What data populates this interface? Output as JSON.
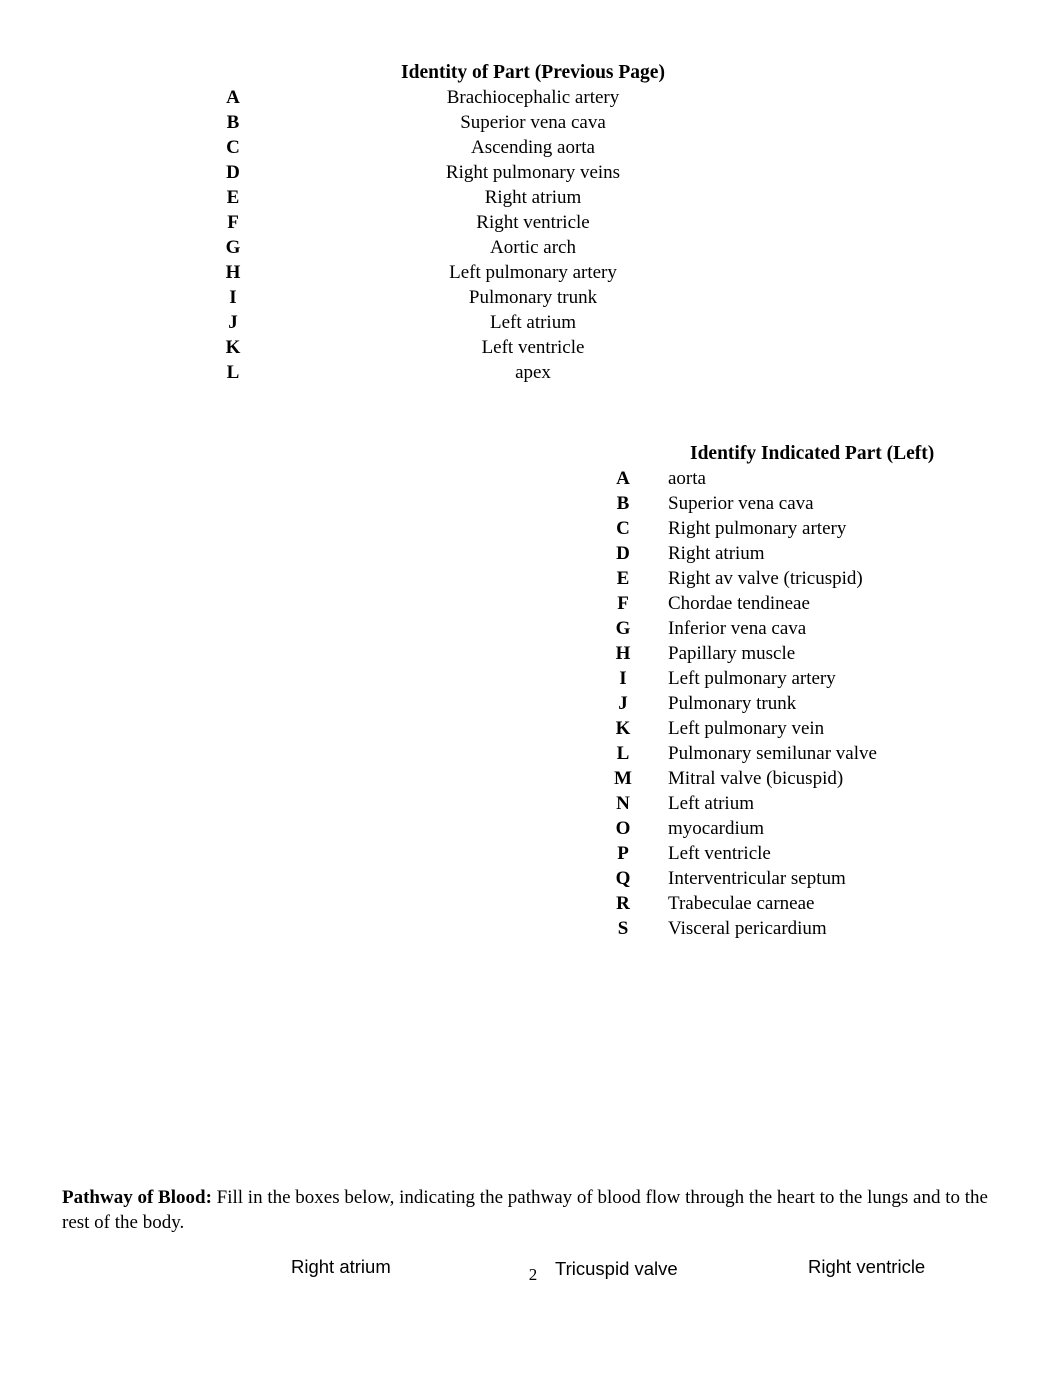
{
  "page": {
    "number": "2",
    "background_color": "#ffffff",
    "text_color": "#000000"
  },
  "section_one": {
    "title": "Identity of Part (Previous Page)",
    "items": [
      {
        "letter": "A",
        "part": "Brachiocephalic artery"
      },
      {
        "letter": "B",
        "part": "Superior vena cava"
      },
      {
        "letter": "C",
        "part": "Ascending aorta"
      },
      {
        "letter": "D",
        "part": "Right pulmonary veins"
      },
      {
        "letter": "E",
        "part": "Right atrium"
      },
      {
        "letter": "F",
        "part": "Right ventricle"
      },
      {
        "letter": "G",
        "part": "Aortic arch"
      },
      {
        "letter": "H",
        "part": "Left pulmonary artery"
      },
      {
        "letter": "I",
        "part": "Pulmonary trunk"
      },
      {
        "letter": "J",
        "part": "Left atrium"
      },
      {
        "letter": "K",
        "part": "Left ventricle"
      },
      {
        "letter": "L",
        "part": "apex"
      }
    ]
  },
  "section_two": {
    "title": "Identify Indicated Part (Left)",
    "items": [
      {
        "letter": "A",
        "part": "aorta"
      },
      {
        "letter": "B",
        "part": "Superior vena cava"
      },
      {
        "letter": "C",
        "part": "Right pulmonary artery"
      },
      {
        "letter": "D",
        "part": "Right atrium"
      },
      {
        "letter": "E",
        "part": "Right av valve (tricuspid)"
      },
      {
        "letter": "F",
        "part": "Chordae tendineae"
      },
      {
        "letter": "G",
        "part": "Inferior vena cava"
      },
      {
        "letter": "H",
        "part": "Papillary muscle"
      },
      {
        "letter": "I",
        "part": "Left pulmonary artery"
      },
      {
        "letter": "J",
        "part": "Pulmonary trunk"
      },
      {
        "letter": "K",
        "part": "Left pulmonary vein"
      },
      {
        "letter": "L",
        "part": "Pulmonary semilunar valve"
      },
      {
        "letter": "M",
        "part": "Mitral valve (bicuspid)"
      },
      {
        "letter": "N",
        "part": "Left atrium"
      },
      {
        "letter": "O",
        "part": "myocardium"
      },
      {
        "letter": "P",
        "part": "Left ventricle"
      },
      {
        "letter": "Q",
        "part": "Interventricular septum"
      },
      {
        "letter": "R",
        "part": "Trabeculae carneae"
      },
      {
        "letter": "S",
        "part": "Visceral pericardium"
      }
    ]
  },
  "pathway": {
    "label": "Pathway of Blood:",
    "instructions": " Fill in the boxes below, indicating the pathway of blood flow through the heart to the lungs and to the rest of the body.",
    "boxes": [
      "Right atrium",
      "Tricuspid valve",
      "Right ventricle"
    ]
  }
}
